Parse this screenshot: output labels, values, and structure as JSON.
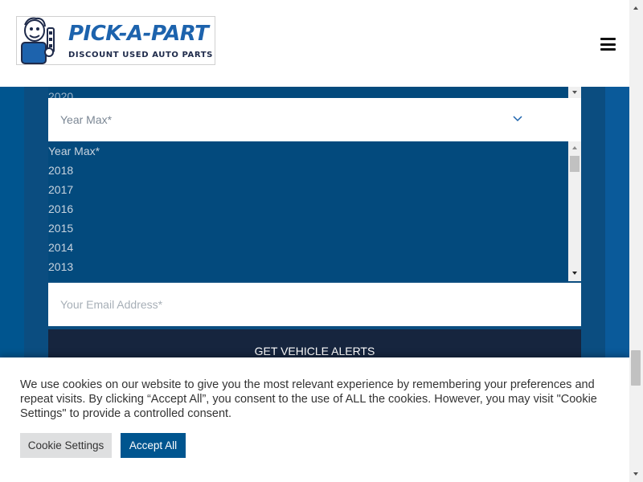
{
  "header": {
    "logo_title": "PICK-A-PART",
    "logo_subtitle": "DISCOUNT USED AUTO PARTS",
    "menu_icon": "hamburger-menu-icon"
  },
  "form": {
    "year_min_scroll_text": "2020",
    "year_max_select": {
      "placeholder": "Year Max*",
      "options": [
        "Year Max*",
        "2018",
        "2017",
        "2016",
        "2015",
        "2014",
        "2013"
      ]
    },
    "email_placeholder": "Your Email Address*",
    "submit_label": "GET VEHICLE ALERTS"
  },
  "cookie_banner": {
    "text": "We use cookies on our website to give you the most relevant experience by remembering your preferences and repeat visits. By clicking “Accept All”, you consent to the use of ALL the cookies. However, you may visit \"Cookie Settings\" to provide a controlled consent.",
    "settings_label": "Cookie Settings",
    "accept_label": "Accept All"
  },
  "colors": {
    "brand_blue": "#00558f",
    "navy_button": "#16253e",
    "dropdown_bg": "#034a7d"
  }
}
